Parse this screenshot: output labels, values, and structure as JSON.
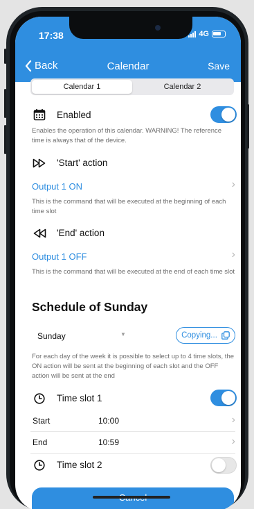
{
  "status": {
    "time": "17:38",
    "network": "4G"
  },
  "nav": {
    "back": "Back",
    "title": "Calendar",
    "save": "Save"
  },
  "tabs": [
    {
      "label": "Calendar 1",
      "active": true
    },
    {
      "label": "Calendar 2",
      "active": false
    }
  ],
  "enabled": {
    "label": "Enabled",
    "on": true,
    "description": "Enables the operation of this calendar. WARNING! The reference time is always that of the device."
  },
  "start_action": {
    "label": "'Start' action",
    "value": "Output 1 ON",
    "description": "This is the command that will be executed at the beginning of each time slot"
  },
  "end_action": {
    "label": "'End' action",
    "value": "Output 1 OFF",
    "description": "This is the command that will be executed at the end of each time slot"
  },
  "schedule": {
    "title": "Schedule of Sunday",
    "day": "Sunday",
    "copy_label": "Copying...",
    "description": "For each day of the week it is possible to select up to 4 time slots, the ON action will be sent at the beginning of each slot and the OFF action will be sent at the end"
  },
  "slots": [
    {
      "label": "Time slot 1",
      "on": true,
      "start_label": "Start",
      "start": "10:00",
      "end_label": "End",
      "end": "10:59"
    },
    {
      "label": "Time slot 2",
      "on": false
    }
  ],
  "bottom_button": "Cancel",
  "colors": {
    "accent": "#2f8ee0"
  },
  "icons": [
    "calendar-icon",
    "fast-forward-icon",
    "rewind-icon",
    "clock-icon",
    "chevron-right-icon",
    "copy-icon",
    "back-chevron-icon"
  ]
}
